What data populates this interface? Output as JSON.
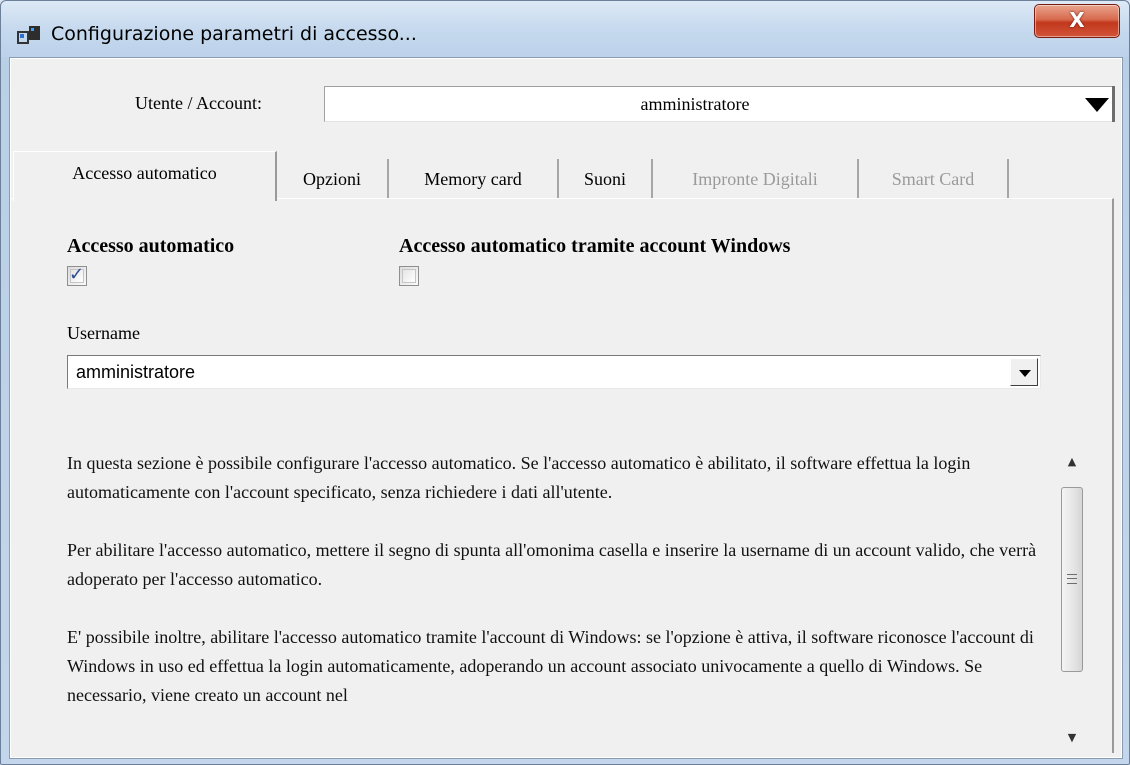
{
  "window": {
    "title": "Configurazione parametri di accesso...",
    "close_glyph": "X"
  },
  "account": {
    "label": "Utente / Account:",
    "value": "amministratore"
  },
  "tabs": [
    {
      "label": "Accesso automatico",
      "active": true,
      "enabled": true
    },
    {
      "label": "Opzioni",
      "active": false,
      "enabled": true
    },
    {
      "label": "Memory card",
      "active": false,
      "enabled": true
    },
    {
      "label": "Suoni",
      "active": false,
      "enabled": true
    },
    {
      "label": "Impronte Digitali",
      "active": false,
      "enabled": false
    },
    {
      "label": "Smart Card",
      "active": false,
      "enabled": false
    }
  ],
  "panel": {
    "auto_access": {
      "label": "Accesso automatico",
      "checked": true
    },
    "windows_access": {
      "label": "Accesso automatico tramite account Windows",
      "checked": false
    },
    "username": {
      "label": "Username",
      "value": "amministratore"
    },
    "help_paragraphs": [
      "In questa sezione è possibile configurare l'accesso automatico. Se l'accesso automatico è abilitato, il software effettua la login automaticamente con l'account specificato, senza richiedere i dati all'utente.",
      "Per abilitare l'accesso automatico, mettere il segno di spunta all'omonima casella e inserire la username di un account valido, che verrà adoperato per l'accesso automatico.",
      "E' possibile inoltre, abilitare l'accesso automatico tramite l'account di Windows: se l'opzione è attiva, il software riconosce l'account di Windows in uso ed effettua la login automaticamente, adoperando un account associato univocamente a quello di Windows. Se necessario, viene creato un account nel"
    ]
  },
  "icons": {
    "app": "app-window-icon",
    "close": "close-icon",
    "dropdown": "chevron-down-icon"
  }
}
